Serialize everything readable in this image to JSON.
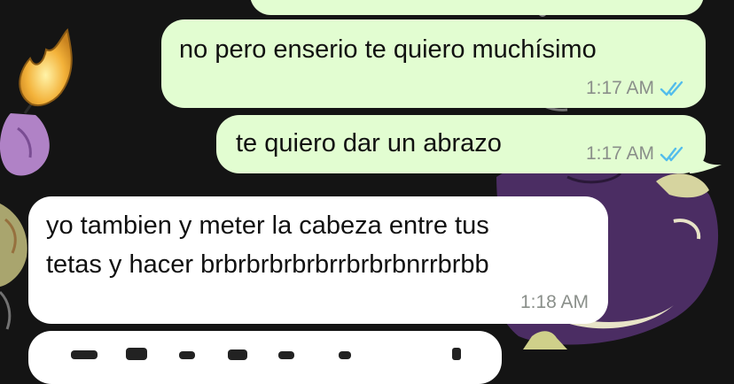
{
  "conversation": {
    "messages": [
      {
        "direction": "outgoing",
        "text": "no pero enserio te quiero muchísimo",
        "time": "1:17 AM",
        "status": "read"
      },
      {
        "direction": "outgoing",
        "text": "te quiero dar un abrazo",
        "time": "1:17 AM",
        "status": "read"
      },
      {
        "direction": "incoming",
        "lines": [
          "yo tambien y meter la cabeza entre tus",
          "tetas y hacer brbrbrbrbrbrrbrbrbnrrbrbb"
        ],
        "time": "1:18 AM"
      }
    ]
  },
  "colors": {
    "outgoing_bubble": "#e2fdd1",
    "incoming_bubble": "#ffffff",
    "read_ticks": "#53bdeb",
    "timestamp": "#8a8f8a"
  },
  "icons": {
    "read_receipt": "double-check-icon"
  }
}
